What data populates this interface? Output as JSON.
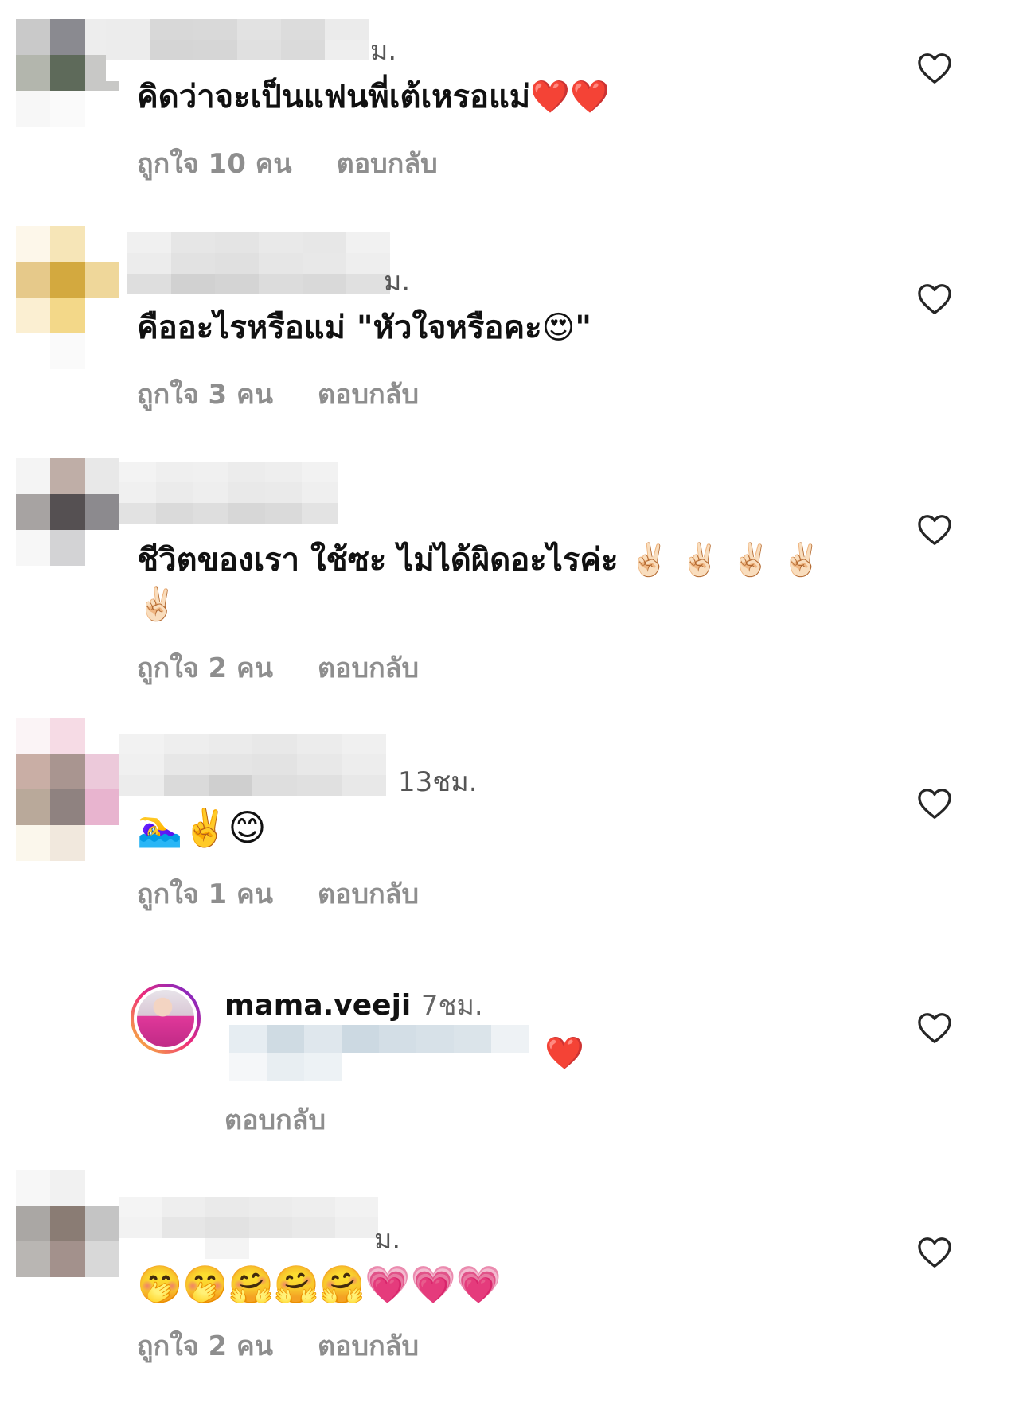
{
  "colors": {
    "text": "#111111",
    "muted": "#8e8e8e",
    "heart_stroke": "#262626",
    "story_ring": [
      "#f9ce34",
      "#ee2a7b",
      "#6228d7"
    ]
  },
  "comments": [
    {
      "time": "ม.",
      "text": "คิดว่าจะเป็นแฟนพี่เต้เหรอแม่❤️❤️",
      "likes": "ถูกใจ 10 คน",
      "reply": "ตอบกลับ"
    },
    {
      "time": "ม.",
      "text": "คืออะไรหรือแม่ \"หัวใจหรือคะ😍\"",
      "likes": "ถูกใจ 3 คน",
      "reply": "ตอบกลับ"
    },
    {
      "time": "",
      "text": "ชีวิตของเรา ใช้ซะ ไม่ได้ผิดอะไรค่ะ ✌🏻 ✌🏻 ✌🏻 ✌🏻 ✌🏻",
      "likes": "ถูกใจ 2 คน",
      "reply": "ตอบกลับ"
    },
    {
      "time": "13ชม.",
      "text": "🏊‍♀️✌️😊",
      "likes": "ถูกใจ 1 คน",
      "reply": "ตอบกลับ"
    },
    {
      "time": "ม.",
      "text": "🤭🤭🤗🤗🤗💗💗💗",
      "likes": "ถูกใจ 2 คน",
      "reply": "ตอบกลับ"
    }
  ],
  "owner_reply": {
    "username": "mama.veeji",
    "time": "7ชม.",
    "text": "❤️",
    "reply": "ตอบกลับ"
  },
  "icons": {
    "like": "heart-outline-icon"
  }
}
